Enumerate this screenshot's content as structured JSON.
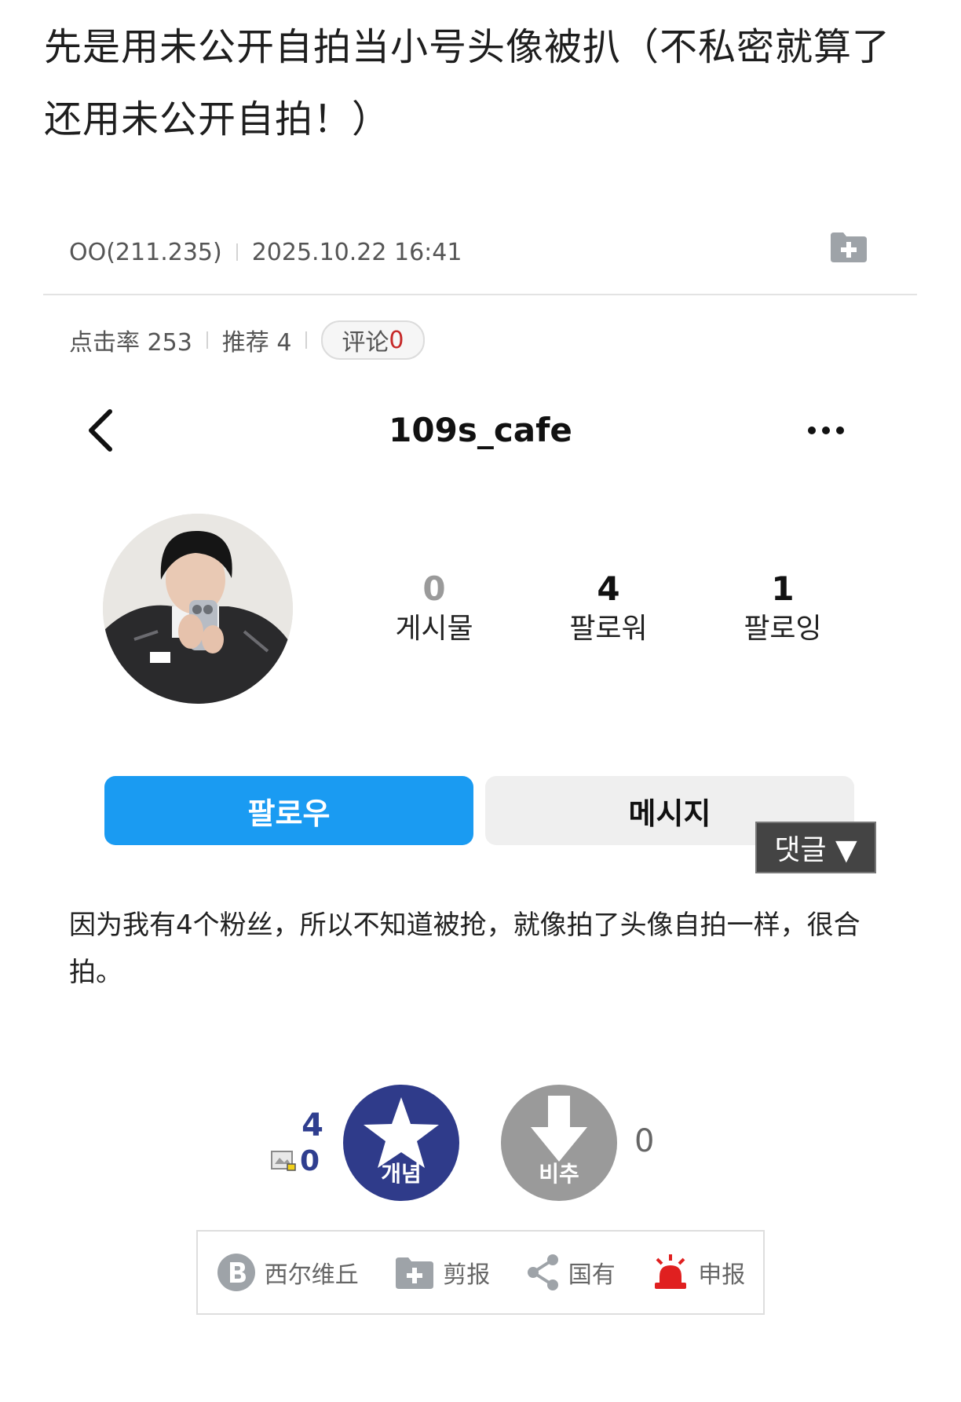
{
  "post": {
    "title": "先是用未公开自拍当小号头像被扒（不私密就算了还用未公开自拍！）",
    "author": "OO(211.235)",
    "datetime": "2025.10.22 16:41",
    "views_label": "点击率 253",
    "recommend_label": "推荐 4",
    "comment_label": "评论",
    "comment_count": "0",
    "body": "因为我有4个粉丝，所以不知道被抢，就像拍了头像自拍一样，很合拍。"
  },
  "profile": {
    "username": "109s_cafe",
    "stats": [
      {
        "num": "0",
        "label": "게시물"
      },
      {
        "num": "4",
        "label": "팔로워"
      },
      {
        "num": "1",
        "label": "팔로잉"
      }
    ],
    "follow_label": "팔로우",
    "message_label": "메시지"
  },
  "overlay": {
    "comment_toggle": "댓글 ▼"
  },
  "votes": {
    "up_count": "4",
    "fixed_count": "0",
    "up_label": "개념",
    "down_label": "비추",
    "down_count": "0"
  },
  "actions": {
    "share_blog": "西尔维丘",
    "scrap": "剪报",
    "share": "国有",
    "report": "申报"
  },
  "colors": {
    "follow": "#1a9bf2",
    "vote_up": "#2f3b8a",
    "vote_down": "#9a9a9a",
    "report": "#e02020"
  }
}
